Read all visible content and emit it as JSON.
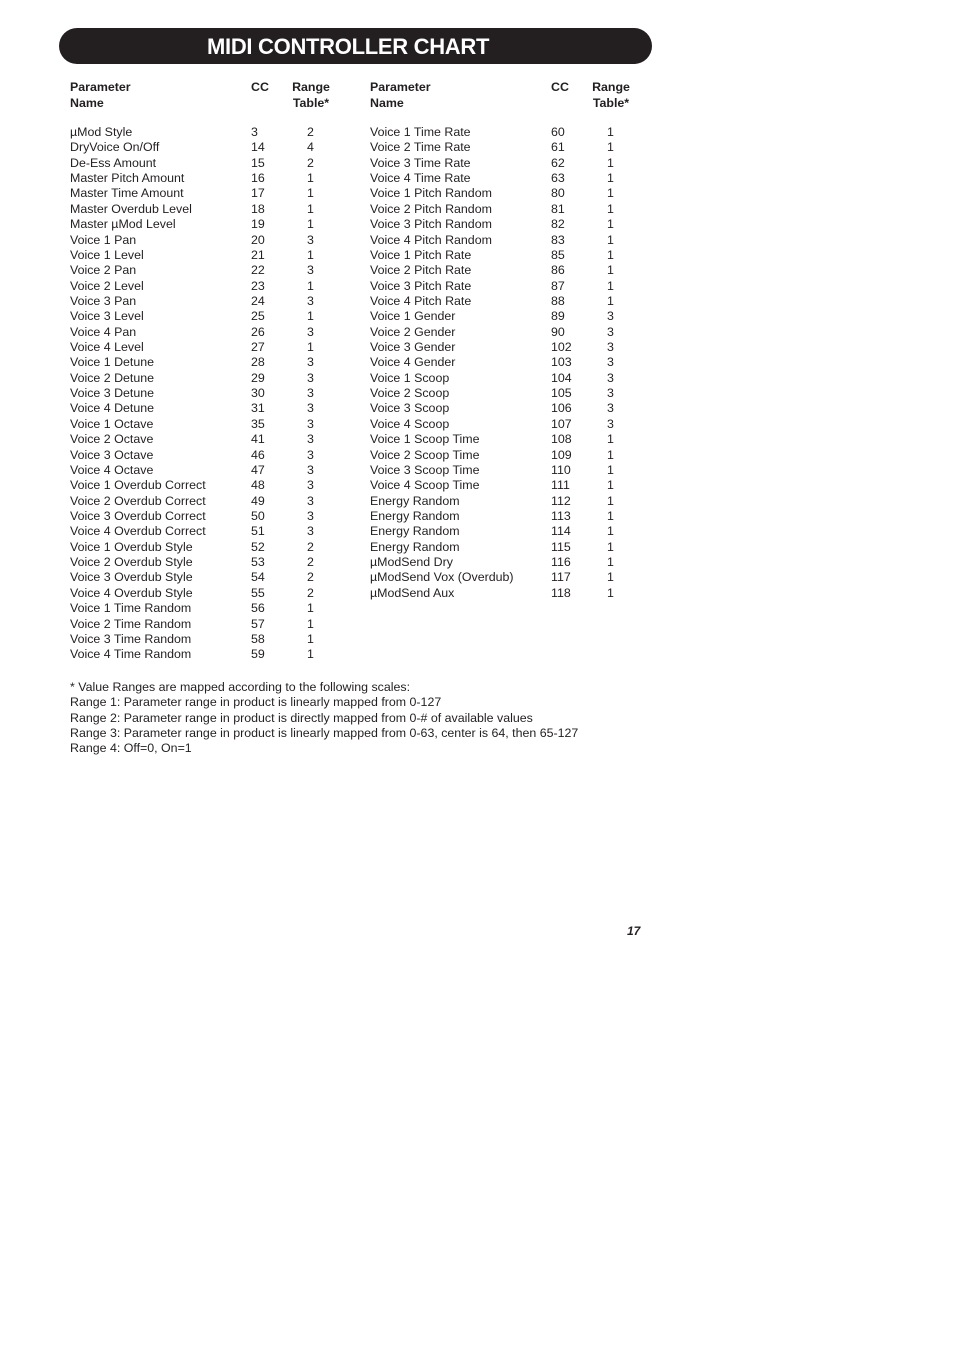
{
  "title": "MIDI CONTROLLER CHART",
  "headers": {
    "parameter_name": "Parameter Name",
    "cc": "CC",
    "range_table_line1": "Range",
    "range_table_line2": "Table*"
  },
  "left_table": [
    {
      "name": "µMod Style",
      "cc": "3",
      "range": "2"
    },
    {
      "name": "DryVoice On/Off",
      "cc": "14",
      "range": "4"
    },
    {
      "name": "De-Ess Amount",
      "cc": "15",
      "range": "2"
    },
    {
      "name": "Master Pitch Amount",
      "cc": "16",
      "range": "1"
    },
    {
      "name": "Master Time Amount",
      "cc": "17",
      "range": "1"
    },
    {
      "name": "Master Overdub Level",
      "cc": "18",
      "range": "1"
    },
    {
      "name": "Master µMod Level",
      "cc": "19",
      "range": "1"
    },
    {
      "name": "Voice 1 Pan",
      "cc": "20",
      "range": "3"
    },
    {
      "name": "Voice 1 Level",
      "cc": "21",
      "range": "1"
    },
    {
      "name": "Voice 2 Pan",
      "cc": "22",
      "range": "3"
    },
    {
      "name": "Voice 2 Level",
      "cc": "23",
      "range": "1"
    },
    {
      "name": "Voice 3 Pan",
      "cc": "24",
      "range": "3"
    },
    {
      "name": "Voice 3 Level",
      "cc": "25",
      "range": "1"
    },
    {
      "name": "Voice 4 Pan",
      "cc": "26",
      "range": "3"
    },
    {
      "name": "Voice 4 Level",
      "cc": "27",
      "range": "1"
    },
    {
      "name": "Voice 1 Detune",
      "cc": "28",
      "range": "3"
    },
    {
      "name": "Voice 2 Detune",
      "cc": "29",
      "range": "3"
    },
    {
      "name": "Voice 3 Detune",
      "cc": "30",
      "range": "3"
    },
    {
      "name": "Voice 4 Detune",
      "cc": "31",
      "range": "3"
    },
    {
      "name": "Voice 1 Octave",
      "cc": "35",
      "range": "3"
    },
    {
      "name": "Voice 2 Octave",
      "cc": "41",
      "range": "3"
    },
    {
      "name": "Voice 3 Octave",
      "cc": "46",
      "range": "3"
    },
    {
      "name": "Voice 4 Octave",
      "cc": "47",
      "range": "3"
    },
    {
      "name": "Voice 1 Overdub Correct",
      "cc": "48",
      "range": "3"
    },
    {
      "name": "Voice 2 Overdub Correct",
      "cc": "49",
      "range": "3"
    },
    {
      "name": "Voice 3 Overdub Correct",
      "cc": "50",
      "range": "3"
    },
    {
      "name": "Voice 4 Overdub Correct",
      "cc": "51",
      "range": "3"
    },
    {
      "name": "Voice 1 Overdub Style",
      "cc": "52",
      "range": "2"
    },
    {
      "name": "Voice 2 Overdub Style",
      "cc": "53",
      "range": "2"
    },
    {
      "name": "Voice 3 Overdub Style",
      "cc": "54",
      "range": "2"
    },
    {
      "name": "Voice 4 Overdub Style",
      "cc": "55",
      "range": "2"
    },
    {
      "name": "Voice 1 Time Random",
      "cc": "56",
      "range": "1"
    },
    {
      "name": "Voice 2 Time Random",
      "cc": "57",
      "range": "1"
    },
    {
      "name": "Voice 3 Time Random",
      "cc": "58",
      "range": "1"
    },
    {
      "name": "Voice 4 Time Random",
      "cc": "59",
      "range": "1"
    }
  ],
  "right_table": [
    {
      "name": "Voice 1 Time Rate",
      "cc": "60",
      "range": "1"
    },
    {
      "name": "Voice 2 Time Rate",
      "cc": "61",
      "range": "1"
    },
    {
      "name": "Voice 3 Time Rate",
      "cc": "62",
      "range": "1"
    },
    {
      "name": "Voice 4 Time Rate",
      "cc": "63",
      "range": "1"
    },
    {
      "name": "Voice 1 Pitch Random",
      "cc": "80",
      "range": "1"
    },
    {
      "name": "Voice 2 Pitch Random",
      "cc": "81",
      "range": "1"
    },
    {
      "name": "Voice 3 Pitch Random",
      "cc": "82",
      "range": "1"
    },
    {
      "name": "Voice 4 Pitch Random",
      "cc": "83",
      "range": "1"
    },
    {
      "name": "Voice 1 Pitch Rate",
      "cc": "85",
      "range": "1"
    },
    {
      "name": "Voice 2 Pitch Rate",
      "cc": "86",
      "range": "1"
    },
    {
      "name": "Voice 3 Pitch Rate",
      "cc": "87",
      "range": "1"
    },
    {
      "name": "Voice 4 Pitch Rate",
      "cc": "88",
      "range": "1"
    },
    {
      "name": "Voice 1 Gender",
      "cc": "89",
      "range": "3"
    },
    {
      "name": "Voice 2 Gender",
      "cc": "90",
      "range": "3"
    },
    {
      "name": "Voice 3 Gender",
      "cc": "102",
      "range": "3"
    },
    {
      "name": "Voice 4 Gender",
      "cc": "103",
      "range": "3"
    },
    {
      "name": "Voice 1 Scoop",
      "cc": "104",
      "range": "3"
    },
    {
      "name": "Voice 2 Scoop",
      "cc": "105",
      "range": "3"
    },
    {
      "name": "Voice 3 Scoop",
      "cc": "106",
      "range": "3"
    },
    {
      "name": "Voice 4 Scoop",
      "cc": "107",
      "range": "3"
    },
    {
      "name": "Voice 1 Scoop Time",
      "cc": "108",
      "range": "1"
    },
    {
      "name": "Voice 2 Scoop Time",
      "cc": "109",
      "range": "1"
    },
    {
      "name": "Voice 3 Scoop Time",
      "cc": "110",
      "range": "1"
    },
    {
      "name": "Voice 4 Scoop Time",
      "cc": "111",
      "range": "1"
    },
    {
      "name": "Energy Random",
      "cc": "112",
      "range": "1"
    },
    {
      "name": "Energy Random",
      "cc": "113",
      "range": "1"
    },
    {
      "name": "Energy Random",
      "cc": "114",
      "range": "1"
    },
    {
      "name": "Energy Random",
      "cc": "115",
      "range": "1"
    },
    {
      "name": "µModSend Dry",
      "cc": "116",
      "range": "1"
    },
    {
      "name": "µModSend Vox (Overdub)",
      "cc": "117",
      "range": "1"
    },
    {
      "name": "µModSend Aux",
      "cc": "118",
      "range": "1"
    }
  ],
  "notes": [
    "* Value Ranges are mapped according to the following scales:",
    "Range 1: Parameter range in product is linearly mapped from 0-127",
    "Range 2: Parameter range in product is directly mapped from 0-# of available values",
    "Range 3: Parameter range in product is linearly mapped from 0-63, center is 64, then 65-127",
    "Range 4: Off=0, On=1"
  ],
  "page_number": "17"
}
